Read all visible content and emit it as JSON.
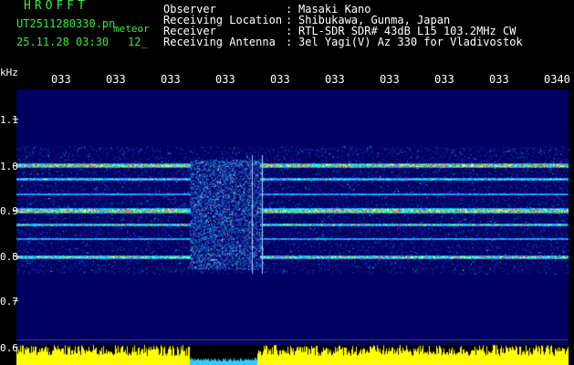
{
  "header": {
    "title": "HROFFT",
    "filename": "UT2511280330.pn",
    "tag": "meteor",
    "datetime": "25.11.28 03:30",
    "count": "12_"
  },
  "info": {
    "rows": [
      {
        "label": "Observer",
        "value": "Masaki Kano"
      },
      {
        "label": "Receiving Location",
        "value": "Shibukawa, Gunma, Japan"
      },
      {
        "label": "Receiver",
        "value": "RTL-SDR SDR# 43dB L15 103.2MHz CW"
      },
      {
        "label": "Receiving Antenna",
        "value": "3el Yagi(V) Az 330 for Vladivostok"
      }
    ]
  },
  "axis": {
    "unit": "kHz",
    "y_ticks": [
      "1.1",
      "1.0",
      "0.9",
      "0.8",
      "0.7",
      "0.6"
    ],
    "time_labels": [
      "033",
      "033",
      "033",
      "033",
      "033",
      "033",
      "033",
      "033",
      "033",
      "0340"
    ]
  },
  "colors": {
    "header_text": "#33ee33",
    "info_text": "#ffffff",
    "background": "#000000",
    "spectro_background": "#000060",
    "signal_bar": "#ffff00",
    "gap_bar": "#33ccff"
  }
}
